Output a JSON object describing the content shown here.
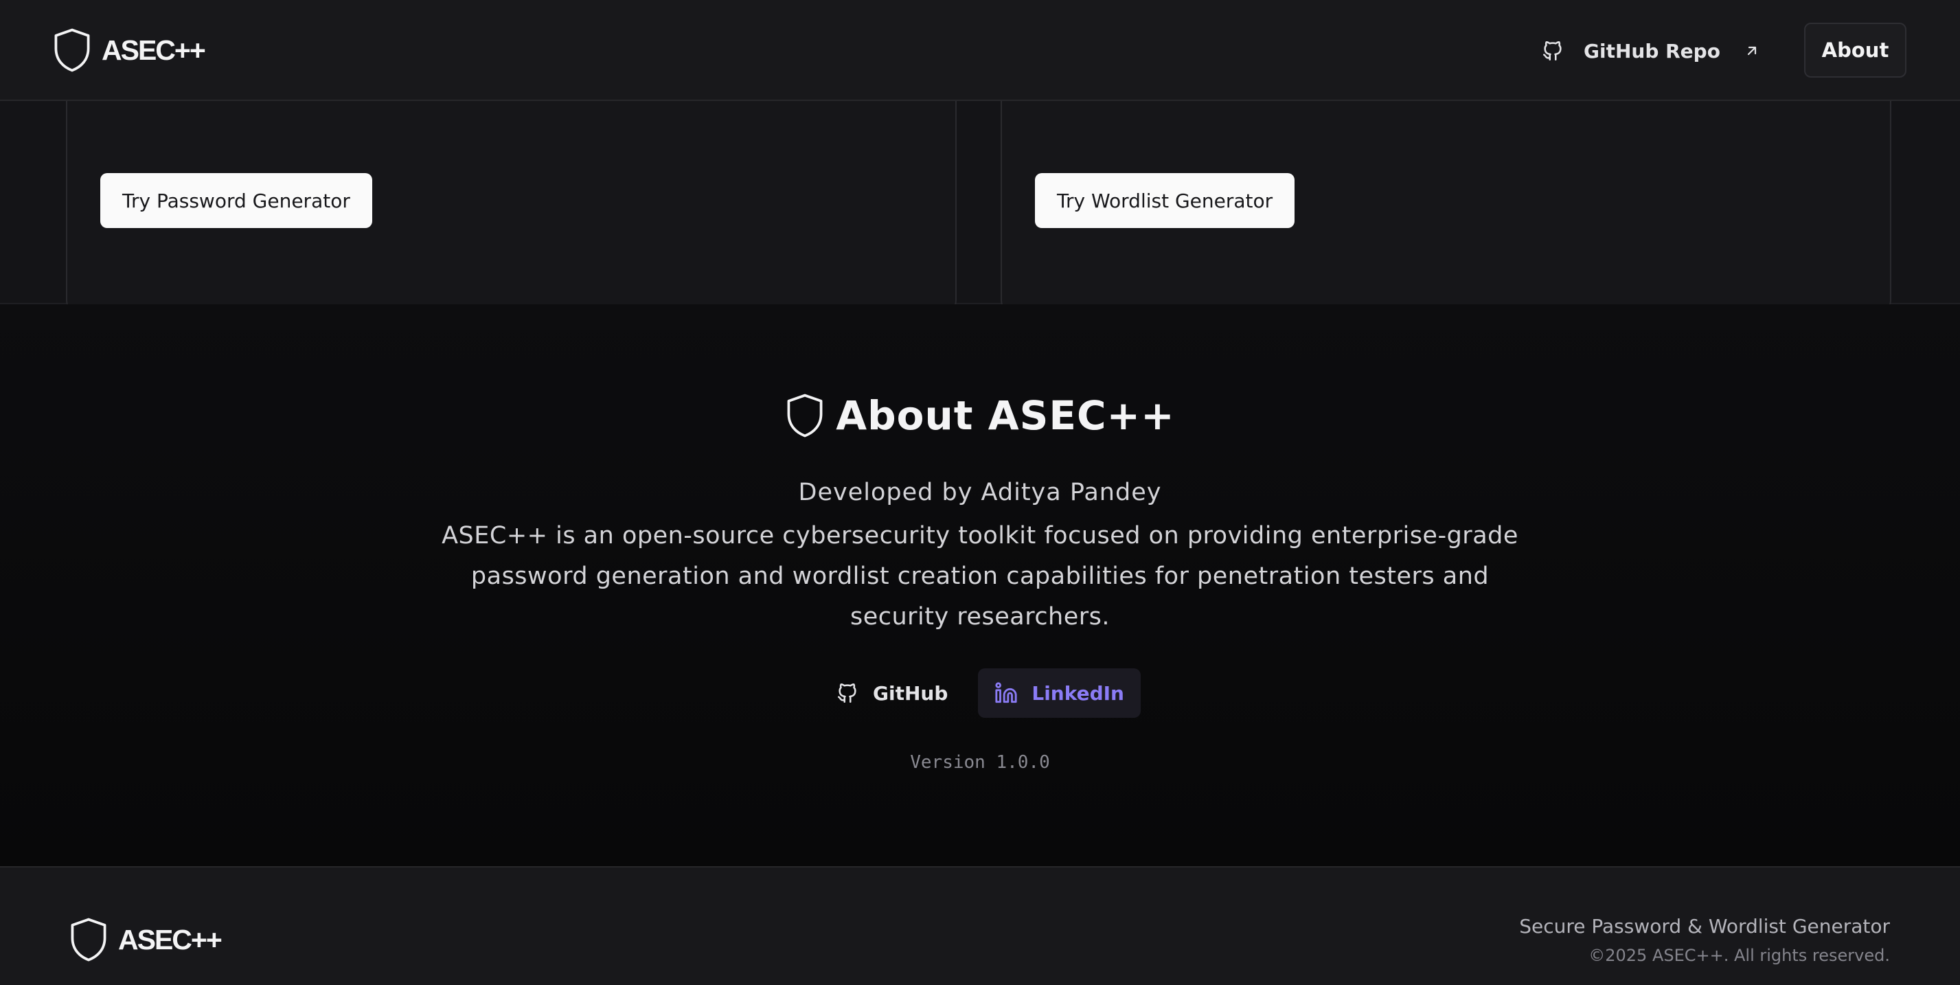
{
  "header": {
    "brand": "ASEC++",
    "github_link": "GitHub Repo",
    "about_button": "About"
  },
  "cards": {
    "password_button": "Try Password Generator",
    "wordlist_button": "Try Wordlist Generator"
  },
  "about": {
    "title": "About ASEC++",
    "developer": "Developed by Aditya Pandey",
    "description": "ASEC++ is an open-source cybersecurity toolkit focused on providing enterprise-grade password generation and wordlist creation capabilities for penetration testers and security researchers.",
    "github": "GitHub",
    "linkedin": "LinkedIn",
    "version": "Version 1.0.0"
  },
  "footer": {
    "brand": "ASEC++",
    "tagline": "Secure Password & Wordlist Generator",
    "copyright": "©2025 ASEC++. All rights reserved."
  },
  "colors": {
    "background": "#0c0c0e",
    "header": "#18181b",
    "accent_linkedin": "#8b7cf6"
  },
  "icons": [
    "shield-icon",
    "github-icon",
    "arrow-up-right-icon",
    "linkedin-icon"
  ]
}
